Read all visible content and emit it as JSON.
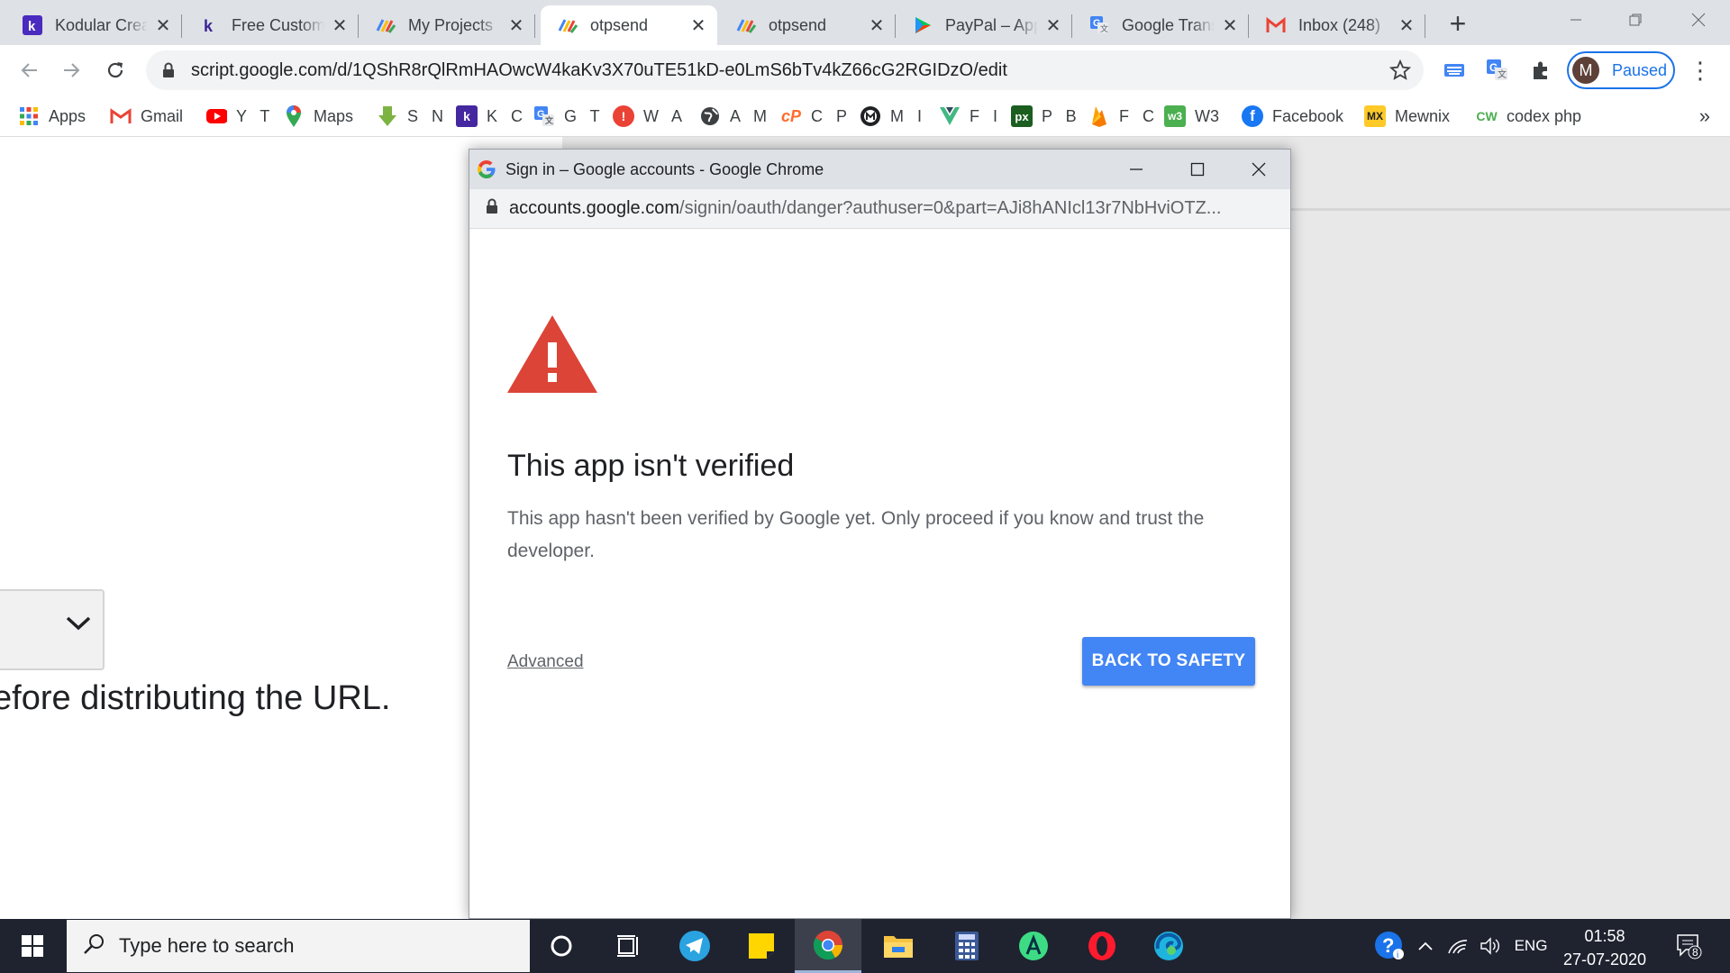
{
  "browser": {
    "tabs": [
      {
        "title": "Kodular Creator",
        "favicon": "kodular-icon",
        "active": false
      },
      {
        "title": "Free Custom Icons",
        "favicon": "kodular-k-icon",
        "active": false
      },
      {
        "title": "My Projects",
        "favicon": "apps-script-icon",
        "active": false
      },
      {
        "title": "otpsend",
        "favicon": "apps-script-icon",
        "active": true
      },
      {
        "title": "otpsend",
        "favicon": "apps-script-icon",
        "active": false
      },
      {
        "title": "PayPal – App",
        "favicon": "play-store-icon",
        "active": false
      },
      {
        "title": "Google Translate",
        "favicon": "google-translate-icon",
        "active": false
      },
      {
        "title": "Inbox (248)",
        "favicon": "gmail-icon",
        "active": false
      }
    ],
    "url": "script.google.com/d/1QShR8rQlRmHAOwcW4kaKv3X70uTE51kD-e0LmS6bTv4kZ66cG2RGIDzO/edit",
    "profile": {
      "initial": "M",
      "status": "Paused"
    }
  },
  "bookmarks": [
    {
      "label": "Apps",
      "icon": "apps-grid-icon",
      "color": "#4285f4"
    },
    {
      "label": "Gmail",
      "icon": "gmail-icon",
      "color": "#ea4335"
    },
    {
      "label": "Y T",
      "icon": "youtube-icon",
      "color": "#ff0000"
    },
    {
      "label": "Maps",
      "icon": "maps-pin-icon",
      "color": "#34a853"
    },
    {
      "label": "S N",
      "icon": "download-arrow-icon",
      "color": "#7cb342"
    },
    {
      "label": "K C",
      "icon": "kodular-icon",
      "color": "#4527a0"
    },
    {
      "label": "G T",
      "icon": "google-translate-icon",
      "color": "#4285f4"
    },
    {
      "label": "W A",
      "icon": "alert-circle-icon",
      "color": "#ea4335"
    },
    {
      "label": "A M",
      "icon": "globe-icon",
      "color": "#3c4043"
    },
    {
      "label": "C P",
      "icon": "cpanel-icon",
      "color": "#ff6c2c"
    },
    {
      "label": "M I",
      "icon": "mi-circle-icon",
      "color": "#202124"
    },
    {
      "label": "F I",
      "icon": "vue-icon",
      "color": "#41b883"
    },
    {
      "label": "P B",
      "icon": "px-icon",
      "color": "#1b5e20"
    },
    {
      "label": "F C",
      "icon": "firebase-icon",
      "color": "#ffa000"
    },
    {
      "label": "W3",
      "icon": "w3-icon",
      "color": "#4caf50"
    },
    {
      "label": "Facebook",
      "icon": "facebook-icon",
      "color": "#1877f2"
    },
    {
      "label": "Mewnix",
      "icon": "mx-icon",
      "color": "#ffca28"
    },
    {
      "label": "codex php",
      "icon": "cw-icon",
      "color": "#4caf50"
    }
  ],
  "background_page": {
    "text": "efore distributing the URL."
  },
  "popup": {
    "window_title": "Sign in – Google accounts - Google Chrome",
    "url_host": "accounts.google.com",
    "url_rest": "/signin/oauth/danger?authuser=0&part=AJi8hANIcl13r7NbHviOTZ...",
    "heading": "This app isn't verified",
    "body": "This app hasn't been verified by Google yet. Only proceed if you know and trust the developer.",
    "advanced_label": "Advanced",
    "back_button": "BACK TO SAFETY",
    "warning_color": "#db4437"
  },
  "taskbar": {
    "search_placeholder": "Type here to search",
    "language": "ENG",
    "time": "01:58",
    "date": "27-07-2020",
    "notification_count": "8"
  }
}
